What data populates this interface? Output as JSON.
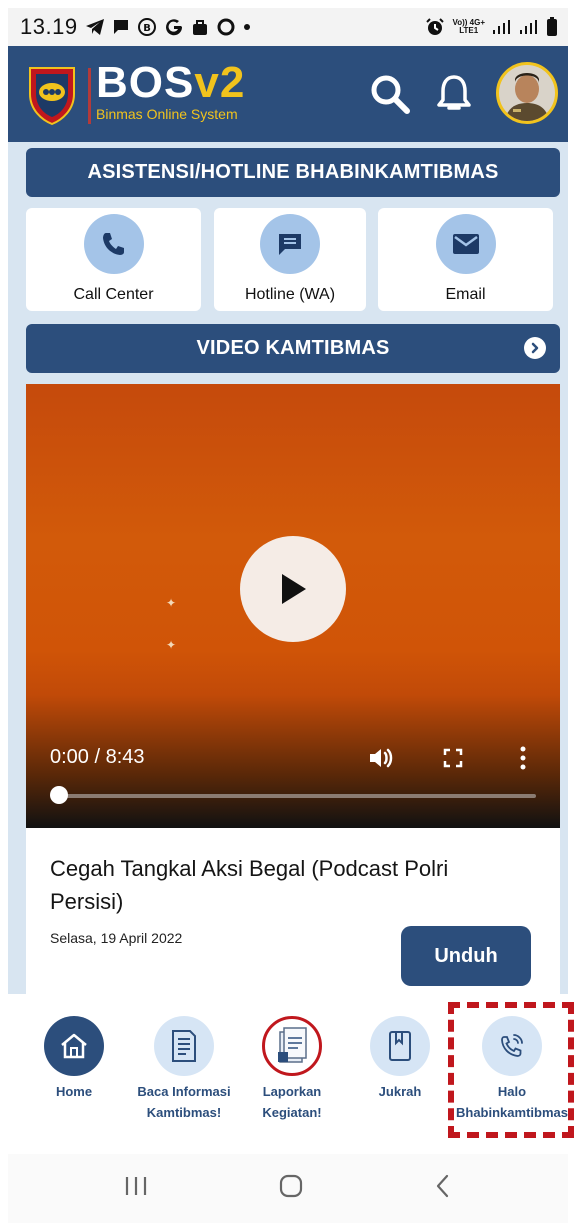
{
  "status_bar": {
    "time": "13.19",
    "network_top": "Vo)) 4G+",
    "network_bottom": "LTE1"
  },
  "header": {
    "brand_main": "BOS",
    "brand_version": "v2",
    "brand_subtitle": "Binmas Online System"
  },
  "asistensi": {
    "title": "ASISTENSI/HOTLINE BHABINKAMTIBMAS",
    "items": [
      {
        "label": "Call Center",
        "icon": "phone-icon"
      },
      {
        "label": "Hotline (WA)",
        "icon": "chat-icon"
      },
      {
        "label": "Email",
        "icon": "mail-icon"
      }
    ]
  },
  "video_section": {
    "title": "VIDEO KAMTIBMAS",
    "player": {
      "time_display": "0:00 / 8:43",
      "progress": 0
    },
    "video_title": "Cegah Tangkal Aksi Begal (Podcast Polri Persisi)",
    "date": "Selasa, 19 April 2022",
    "download_label": "Unduh"
  },
  "bottom_nav": {
    "items": [
      {
        "label": "Home",
        "icon": "home-icon",
        "active": true
      },
      {
        "label": "Baca Informasi Kamtibmas!",
        "icon": "document-icon"
      },
      {
        "label": "Laporkan Kegiatan!",
        "icon": "report-icon"
      },
      {
        "label": "Jukrah",
        "icon": "book-icon"
      },
      {
        "label": "Halo Bhabinkamtibmas",
        "icon": "phone-ringing-icon"
      }
    ]
  },
  "colors": {
    "primary": "#2c4e7c",
    "accent": "#f1c31d",
    "content_bg": "#d8e5f1",
    "highlight": "#c0171d"
  }
}
